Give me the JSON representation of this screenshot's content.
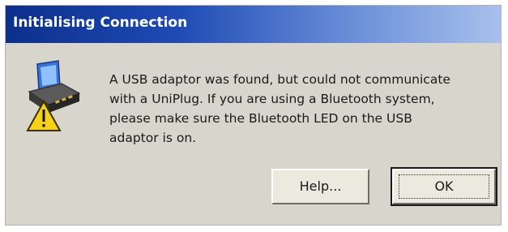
{
  "dialog": {
    "title": "Initialising Connection",
    "icon": "usb-adaptor-warning-icon",
    "message_lines": [
      "A USB adaptor was found, but could not communicate",
      "with a UniPlug.  If you are using a Bluetooth system,",
      "please make sure the Bluetooth LED on the USB",
      "adaptor is on."
    ],
    "buttons": {
      "help_label": "Help...",
      "ok_label": "OK"
    }
  },
  "colors": {
    "title_start": "#0c2f8c",
    "title_end": "#a8c0ec",
    "dialog_bg": "#d8d5cc",
    "warning_yellow": "#f5d21a"
  }
}
